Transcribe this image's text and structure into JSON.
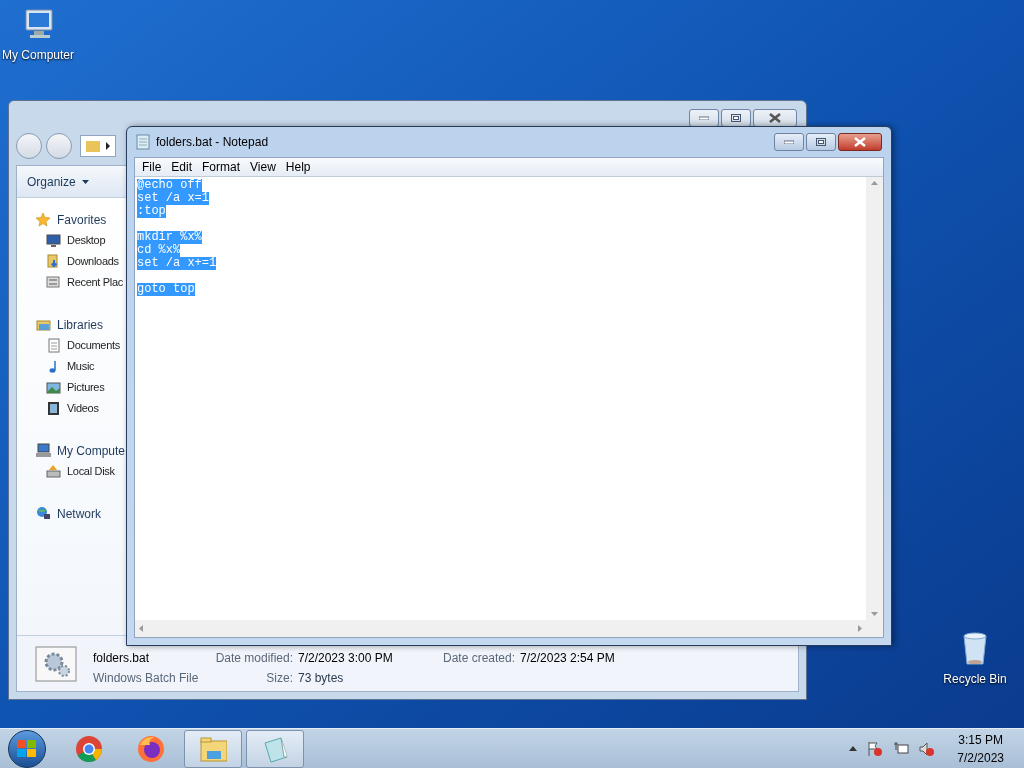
{
  "desktop_icons": [
    {
      "label": "My Computer",
      "kind": "computer"
    },
    {
      "label": "Recycle Bin",
      "kind": "bin"
    }
  ],
  "explorer": {
    "organize": "Organize",
    "sidebar": [
      {
        "label": "Favorites",
        "kind": "star",
        "children": [
          {
            "label": "Desktop",
            "kind": "desktop"
          },
          {
            "label": "Downloads",
            "kind": "download"
          },
          {
            "label": "Recent Plac",
            "kind": "recent"
          }
        ]
      },
      {
        "label": "Libraries",
        "kind": "library",
        "children": [
          {
            "label": "Documents",
            "kind": "document"
          },
          {
            "label": "Music",
            "kind": "music"
          },
          {
            "label": "Pictures",
            "kind": "picture"
          },
          {
            "label": "Videos",
            "kind": "video"
          }
        ]
      },
      {
        "label": "My Compute",
        "kind": "computer",
        "children": [
          {
            "label": "Local Disk",
            "kind": "disk"
          }
        ]
      },
      {
        "label": "Network",
        "kind": "network"
      }
    ],
    "details": {
      "name": "folders.bat",
      "type": "Windows Batch File",
      "modified_label": "Date modified:",
      "modified": "7/2/2023 3:00 PM",
      "created_label": "Date created:",
      "created": "7/2/2023 2:54 PM",
      "size_label": "Size:",
      "size": "73 bytes"
    }
  },
  "notepad": {
    "title": "folders.bat - Notepad",
    "menu": [
      "File",
      "Edit",
      "Format",
      "View",
      "Help"
    ],
    "selected": true,
    "paragraphs": [
      [
        "@echo off",
        "set /a x=1",
        ":top"
      ],
      [
        "mkdir %x%",
        "cd %x%",
        "set /a x+=1"
      ],
      [
        "goto top"
      ]
    ]
  },
  "taskbar": {
    "apps": [
      {
        "kind": "chrome",
        "selected": false
      },
      {
        "kind": "firefox",
        "selected": false
      },
      {
        "kind": "explorer",
        "selected": true
      },
      {
        "kind": "notepad",
        "selected": true
      }
    ],
    "tray": {
      "time": "3:15 PM",
      "date": "7/2/2023"
    }
  }
}
